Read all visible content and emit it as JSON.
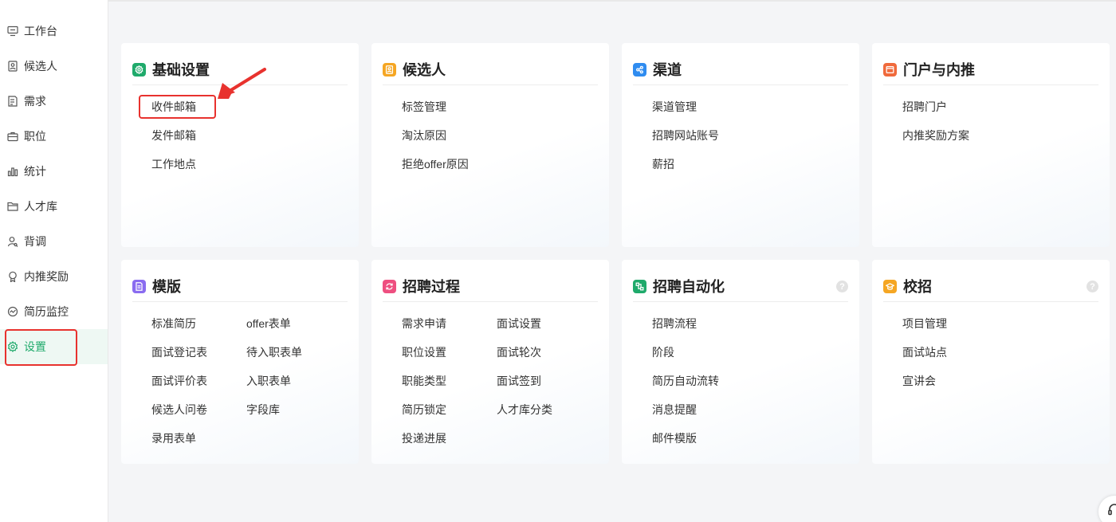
{
  "sidebar": {
    "items": [
      {
        "label": "工作台",
        "icon": "monitor-icon"
      },
      {
        "label": "候选人",
        "icon": "id-card-icon"
      },
      {
        "label": "需求",
        "icon": "document-icon"
      },
      {
        "label": "职位",
        "icon": "briefcase-icon"
      },
      {
        "label": "统计",
        "icon": "bar-chart-icon"
      },
      {
        "label": "人才库",
        "icon": "folder-icon"
      },
      {
        "label": "背调",
        "icon": "person-search-icon"
      },
      {
        "label": "内推奖励",
        "icon": "award-icon"
      },
      {
        "label": "简历监控",
        "icon": "monitor-chart-icon"
      },
      {
        "label": "设置",
        "icon": "gear-icon",
        "active": true
      }
    ]
  },
  "cards": {
    "basic": {
      "title": "基础设置",
      "icon": "gear-icon",
      "color": "#1faa6b",
      "links": [
        "收件邮箱",
        "发件邮箱",
        "工作地点"
      ]
    },
    "candidate": {
      "title": "候选人",
      "icon": "id-card-icon",
      "color": "#f5a623",
      "links": [
        "标签管理",
        "淘汰原因",
        "拒绝offer原因"
      ]
    },
    "channel": {
      "title": "渠道",
      "icon": "share-icon",
      "color": "#2f8cf0",
      "links": [
        "渠道管理",
        "招聘网站账号",
        "薪招"
      ]
    },
    "portal": {
      "title": "门户与内推",
      "icon": "browser-icon",
      "color": "#f06a3c",
      "links": [
        "招聘门户",
        "内推奖励方案"
      ]
    },
    "template": {
      "title": "模版",
      "icon": "document-icon",
      "color": "#8a6cf0",
      "links": [
        "标准简历",
        "offer表单",
        "面试登记表",
        "待入职表单",
        "面试评价表",
        "入职表单",
        "候选人问卷",
        "字段库",
        "录用表单"
      ]
    },
    "process": {
      "title": "招聘过程",
      "icon": "refresh-icon",
      "color": "#ee4f80",
      "links": [
        "需求申请",
        "面试设置",
        "职位设置",
        "面试轮次",
        "职能类型",
        "面试签到",
        "简历锁定",
        "人才库分类",
        "投递进展"
      ]
    },
    "automation": {
      "title": "招聘自动化",
      "icon": "flow-icon",
      "color": "#1faa6b",
      "help": "?",
      "links": [
        "招聘流程",
        "阶段",
        "简历自动流转",
        "消息提醒",
        "邮件模版"
      ]
    },
    "campus": {
      "title": "校招",
      "icon": "graduation-cap-icon",
      "color": "#f5a623",
      "help": "?",
      "links": [
        "项目管理",
        "面试站点",
        "宣讲会"
      ]
    }
  }
}
